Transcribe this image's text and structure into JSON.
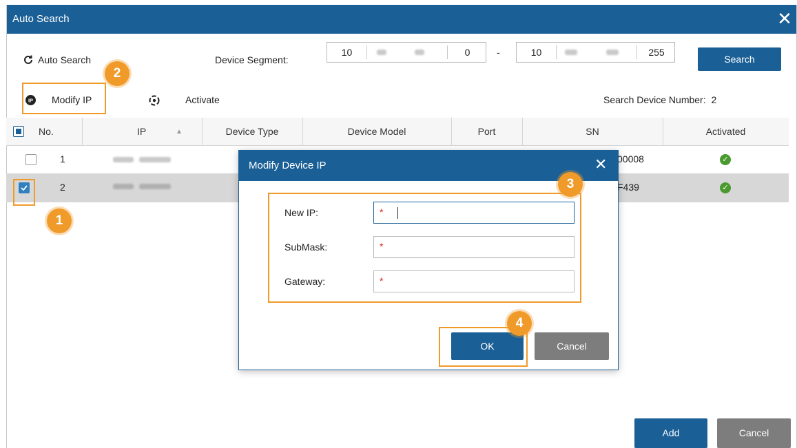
{
  "window": {
    "title": "Auto Search",
    "close_glyph": "✕"
  },
  "toolbar": {
    "auto_search_label": "Auto Search",
    "device_segment_label": "Device Segment:",
    "ip_start": [
      "10",
      "",
      "",
      "0"
    ],
    "ip_separator": "-",
    "ip_end": [
      "10",
      "",
      "",
      "255"
    ],
    "search_button": "Search",
    "modify_ip_label": "Modify IP",
    "activate_label": "Activate",
    "device_count_label": "Search Device Number:",
    "device_count_value": "2"
  },
  "table": {
    "columns": [
      "No.",
      "IP",
      "Device Type",
      "Device Model",
      "Port",
      "SN",
      "Activated"
    ],
    "sort_indicator": "▲",
    "rows": [
      {
        "no": "1",
        "sn_visible": "00008",
        "checked": false
      },
      {
        "no": "2",
        "sn_visible": "F439",
        "checked": true
      }
    ]
  },
  "dialog": {
    "title": "Modify Device IP",
    "close_glyph": "✕",
    "fields": [
      {
        "label": "New IP:",
        "required_mark": "*"
      },
      {
        "label": "SubMask:",
        "required_mark": "*"
      },
      {
        "label": "Gateway:",
        "required_mark": "*"
      }
    ],
    "ok_button": "OK",
    "cancel_button": "Cancel"
  },
  "footer": {
    "add_button": "Add",
    "cancel_button": "Cancel"
  },
  "step_badges": [
    "1",
    "2",
    "3",
    "4"
  ],
  "colors": {
    "accent": "#1a5f96",
    "highlight": "#f09a2a",
    "activated": "#4a9a2f",
    "secondary_button": "#7d7d7d"
  },
  "icons": {
    "refresh": "refresh-icon",
    "modify_ip": "ip-icon",
    "activate": "activate-icon",
    "check": "check-circle-icon"
  }
}
